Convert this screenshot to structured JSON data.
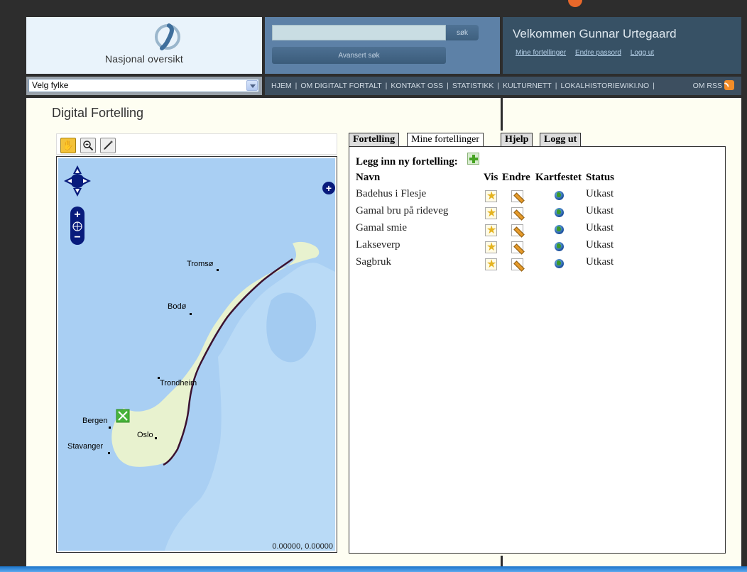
{
  "header": {
    "logo_text": "Nasjonal oversikt",
    "search_placeholder": "",
    "search_button": "søk",
    "advanced_button": "Avansert søk",
    "welcome_title": "Velkommen Gunnar Urtegaard",
    "user_links": [
      "Mine fortellinger",
      "Endre passord",
      "Logg ut"
    ]
  },
  "county_select": {
    "value": "Velg fylke"
  },
  "nav": {
    "items": [
      "HJEM",
      "OM DIGITALT FORTALT",
      "KONTAKT OSS",
      "STATISTIKK",
      "KULTURNETT",
      "LOKALHISTORIEWIKI.NO"
    ],
    "separator": "|",
    "rss_label": "OM RSS"
  },
  "page": {
    "title": "Digital Fortelling"
  },
  "map": {
    "tools": [
      "pan-hand-icon",
      "zoom-in-icon",
      "draw-pencil-icon"
    ],
    "cities": [
      {
        "name": "Tromsø"
      },
      {
        "name": "Bodø"
      },
      {
        "name": "Trondheim"
      },
      {
        "name": "Bergen"
      },
      {
        "name": "Oslo"
      },
      {
        "name": "Stavanger"
      }
    ],
    "coordinates": "0.00000, 0.00000",
    "colors": {
      "sea": "#a9cff3",
      "land": "#e8f2cf",
      "border": "#3b1230",
      "marker": "#47b33a"
    }
  },
  "panel": {
    "tabs": [
      "Fortelling",
      "Mine fortellinger",
      "Hjelp",
      "Logg ut"
    ],
    "active_tab": "Mine fortellinger",
    "add_label": "Legg inn ny fortelling:",
    "columns": {
      "name": "Navn",
      "vis": "Vis",
      "endre": "Endre",
      "kartfestet": "Kartfestet",
      "status": "Status"
    },
    "stories": [
      {
        "name": "Badehus i Flesje",
        "status": "Utkast"
      },
      {
        "name": "Gamal bru på rideveg",
        "status": "Utkast"
      },
      {
        "name": "Gamal smie",
        "status": "Utkast"
      },
      {
        "name": "Lakseverp",
        "status": "Utkast"
      },
      {
        "name": "Sagbruk",
        "status": "Utkast"
      }
    ]
  }
}
